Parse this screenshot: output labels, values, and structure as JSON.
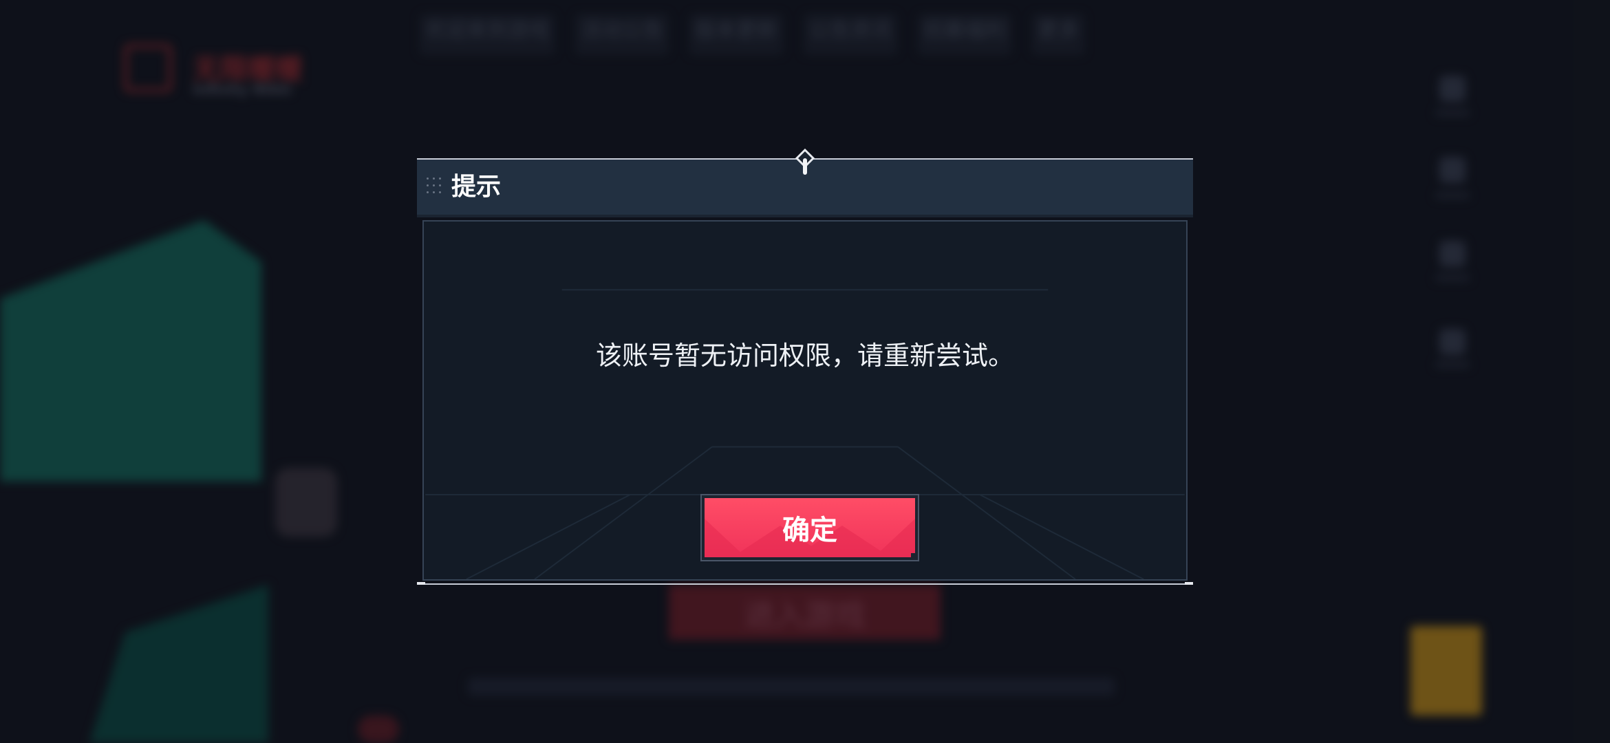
{
  "background": {
    "logo_text": "无限暖暖",
    "logo_sub": "Infinity Nikki",
    "tabs": [
      "欢迎来到游戏",
      "活动公告",
      "版本更新",
      "公告资讯",
      "招募福利",
      "更多"
    ],
    "enter_button": "进入游戏"
  },
  "dialog": {
    "title": "提示",
    "message": "该账号暂无访问权限，请重新尝试。",
    "confirm_label": "确定"
  },
  "colors": {
    "dialog_header": "#223041",
    "dialog_body": "#131b26",
    "confirm_button": "#f0335a",
    "background": "#141721"
  },
  "icons": {
    "drag_handle": "drag-handle-icon",
    "top_knob": "pin-knob-icon"
  }
}
